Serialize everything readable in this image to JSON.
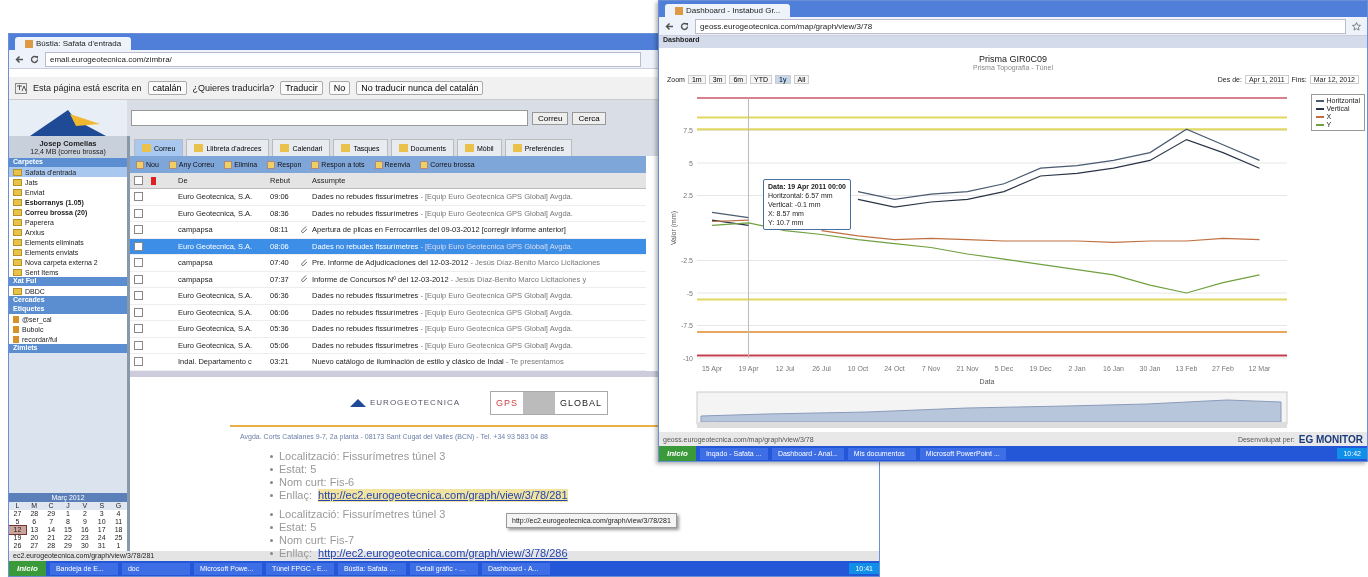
{
  "mail_window": {
    "tab_title": "Bústia: Safata d'entrada",
    "address": "email.eurogeotecnica.com/zimbra/",
    "translate_bar": {
      "message": "Esta página está escrita en",
      "language": "catalán",
      "question": "¿Quieres traducirla?",
      "buttons": [
        "Traducir",
        "No",
        "No traducir nunca del catalán"
      ]
    },
    "search": {
      "scope": "Correu",
      "button": "Cerca"
    },
    "user": {
      "name": "Josep Comellas",
      "quota": "12,4 MB (correu brossa)"
    },
    "app_tabs": [
      {
        "label": "Correu",
        "selected": true
      },
      {
        "label": "Llibreta d'adreces",
        "selected": false
      },
      {
        "label": "Calendari",
        "selected": false
      },
      {
        "label": "Tasques",
        "selected": false
      },
      {
        "label": "Documents",
        "selected": false
      },
      {
        "label": "Mòbil",
        "selected": false
      },
      {
        "label": "Preferències",
        "selected": false
      }
    ],
    "sidebar": [
      {
        "title": "Carpetes",
        "items": [
          {
            "label": "Safata d'entrada",
            "selected": true,
            "bold": false
          },
          {
            "label": "Jats",
            "selected": false,
            "bold": false
          },
          {
            "label": "Enviat",
            "selected": false,
            "bold": false
          },
          {
            "label": "Esborranys (1.05)",
            "selected": false,
            "bold": true
          },
          {
            "label": "Correu brossa (20)",
            "selected": false,
            "bold": true
          },
          {
            "label": "Paperera",
            "selected": false,
            "bold": false
          },
          {
            "label": "Arxius",
            "selected": false,
            "bold": false
          },
          {
            "label": "Elements eliminats",
            "selected": false,
            "bold": false
          },
          {
            "label": "Elements enviats",
            "selected": false,
            "bold": false
          },
          {
            "label": "Nova carpeta externa 2",
            "selected": false,
            "bold": false
          },
          {
            "label": "Sent Items",
            "selected": false,
            "bold": false
          }
        ]
      },
      {
        "title": "Xat Ful",
        "items": [
          {
            "label": "DBDC",
            "selected": false,
            "bold": false
          }
        ]
      },
      {
        "title": "Cercades"
      },
      {
        "title": "Etiquetes",
        "items": [
          {
            "label": "@ser_cal",
            "selected": false,
            "bold": false
          },
          {
            "label": "Bubolc",
            "selected": false,
            "bold": false
          },
          {
            "label": "recordar/ful",
            "selected": false,
            "bold": false
          }
        ]
      },
      {
        "title": "Zimlets"
      }
    ],
    "calendar": {
      "month": "Març 2012",
      "weekdays": [
        "L",
        "M",
        "C",
        "J",
        "V",
        "S",
        "G"
      ],
      "days": [
        {
          "label": "27",
          "today": false
        },
        {
          "label": "28",
          "today": false
        },
        {
          "label": "29",
          "today": false
        },
        {
          "label": "1",
          "today": false
        },
        {
          "label": "2",
          "today": false
        },
        {
          "label": "3",
          "today": false
        },
        {
          "label": "4",
          "today": false
        },
        {
          "label": "5",
          "today": false
        },
        {
          "label": "6",
          "today": false
        },
        {
          "label": "7",
          "today": false
        },
        {
          "label": "8",
          "today": false
        },
        {
          "label": "9",
          "today": false
        },
        {
          "label": "10",
          "today": false
        },
        {
          "label": "11",
          "today": false
        },
        {
          "label": "12",
          "today": true
        },
        {
          "label": "13",
          "today": false
        },
        {
          "label": "14",
          "today": false
        },
        {
          "label": "15",
          "today": false
        },
        {
          "label": "16",
          "today": false
        },
        {
          "label": "17",
          "today": false
        },
        {
          "label": "18",
          "today": false
        },
        {
          "label": "19",
          "today": false
        },
        {
          "label": "20",
          "today": false
        },
        {
          "label": "21",
          "today": false
        },
        {
          "label": "22",
          "today": false
        },
        {
          "label": "23",
          "today": false
        },
        {
          "label": "24",
          "today": false
        },
        {
          "label": "25",
          "today": false
        },
        {
          "label": "26",
          "today": false
        },
        {
          "label": "27",
          "today": false
        },
        {
          "label": "28",
          "today": false
        },
        {
          "label": "29",
          "today": false
        },
        {
          "label": "30",
          "today": false
        },
        {
          "label": "31",
          "today": false
        },
        {
          "label": "1",
          "today": false
        }
      ]
    },
    "toolbar": [
      "Nou",
      "Any Correu",
      "Elimina",
      "Respon",
      "Respon a tots",
      "Reenvia",
      "Correu brossa"
    ],
    "table": {
      "columns": [
        "De",
        "Rebut",
        "Assumpte"
      ],
      "all_checked": false,
      "rows": [
        {
          "from": "Euro Geotecnica, S.A.",
          "received": "09:06",
          "subject": "Dades no rebudes fissurímetres",
          "preview": "- [Equip Euro Geotecnica GPS Global] Avgda.",
          "attachment": false,
          "checked": false,
          "selected": false
        },
        {
          "from": "Euro Geotecnica, S.A.",
          "received": "08:36",
          "subject": "Dades no rebudes fissurímetres",
          "preview": "- [Equip Euro Geotecnica GPS Global] Avgda.",
          "attachment": false,
          "checked": false,
          "selected": false
        },
        {
          "from": "campapsa",
          "received": "08:11",
          "subject": "Apertura de plicas en Ferrocarriles del 09-03-2012 [corregir informe anterior]",
          "attachment": true,
          "checked": false,
          "selected": false
        },
        {
          "from": "Euro Geotecnica, S.A.",
          "received": "08:06",
          "subject": "Dades no rebudes fissurímetres",
          "preview": "- [Equip Euro Geotecnica GPS Global] Avgda.",
          "attachment": false,
          "checked": false,
          "selected": true
        },
        {
          "from": "campapsa",
          "received": "07:40",
          "subject": "Pre. Informe de Adjudicaciones del 12-03-2012",
          "preview": "- Jesús Díaz-Benito Marco Licitaciones",
          "attachment": true,
          "checked": false,
          "selected": false
        },
        {
          "from": "campapsa",
          "received": "07:37",
          "subject": "Informe de Concursos Nº del 12-03-2012",
          "preview": "- Jesús Díaz-Benito Marco Licitaciones y",
          "attachment": true,
          "checked": false,
          "selected": false
        },
        {
          "from": "Euro Geotecnica, S.A.",
          "received": "06:36",
          "subject": "Dades no rebudes fissurímetres",
          "preview": "- [Equip Euro Geotecnica GPS Global] Avgda.",
          "attachment": false,
          "checked": false,
          "selected": false
        },
        {
          "from": "Euro Geotecnica, S.A.",
          "received": "06:06",
          "subject": "Dades no rebudes fissurímetres",
          "preview": "- [Equip Euro Geotecnica GPS Global] Avgda.",
          "attachment": false,
          "checked": false,
          "selected": false
        },
        {
          "from": "Euro Geotecnica, S.A.",
          "received": "05:36",
          "subject": "Dades no rebudes fissurímetres",
          "preview": "- [Equip Euro Geotecnica GPS Global] Avgda.",
          "attachment": false,
          "checked": false,
          "selected": false
        },
        {
          "from": "Euro Geotecnica, S.A.",
          "received": "05:06",
          "subject": "Dades no rebudes fissurímetres",
          "preview": "- [Equip Euro Geotecnica GPS Global] Avgda.",
          "attachment": false,
          "checked": false,
          "selected": false
        },
        {
          "from": "Indal. Departamento c",
          "received": "03:21",
          "subject": "Nuevo catálogo de iluminación de estilo y clásico de Indal",
          "preview": "- Te presentamos",
          "attachment": false,
          "checked": false,
          "selected": false
        }
      ]
    },
    "message": {
      "logo_left": "EUROGEOTECNICA",
      "logo_right_a": "GPS",
      "logo_right_b": "GLOBAL",
      "address": "Avgda. Corts Catalanes 9-7, 2a planta - 08173 Sant Cugat del Vallès (BCN) - Tel. +34 93 583 04 88",
      "items": [
        {
          "lines": [
            "Localització: Fissurímetres túnel 3",
            "Estat: 5",
            "Nom curt: Fis-6"
          ],
          "link_label": "Enllaç:",
          "link": "http://ec2.eurogeotecnica.com/graph/view/3/78/281",
          "hovered": true
        },
        {
          "lines": [
            "Localització: Fissurímetres túnel 3",
            "Estat: 5",
            "Nom curt: Fis-7"
          ],
          "link_label": "Enllaç:",
          "link": "http://ec2.eurogeotecnica.com/graph/view/3/78/286",
          "hovered": false
        }
      ],
      "tooltip": "http://ec2.eurogeotecnica.com/graph/view/3/78/281"
    },
    "status_url": "ec2.eurogeotecnica.com/graph/view/3/78/281",
    "taskbar": {
      "start": "Inicio",
      "tasks": [
        "Bandeja de E...",
        "doc",
        "Microsoft Powe...",
        "Túnel FPGC - E...",
        "Bústia: Safata ...",
        "Detall gràfic - ...",
        "Dashboard - A..."
      ],
      "clock": "10:41"
    }
  },
  "chart_window": {
    "tab_title": "Dashboard - Instabud Gr...",
    "address": "geoss.eurogeotecnica.com/map/graph/view/3/78",
    "toolbar_label": "Dashboard",
    "chart": {
      "title": "Prisma GIR0C09",
      "subtitle": "Prisma Topografia - Túnel",
      "zoom_label": "Zoom",
      "zoom_buttons": [
        {
          "label": "1m",
          "selected": false
        },
        {
          "label": "3m",
          "selected": false
        },
        {
          "label": "6m",
          "selected": false
        },
        {
          "label": "YTD",
          "selected": false
        },
        {
          "label": "1y",
          "selected": true
        },
        {
          "label": "All",
          "selected": false
        }
      ],
      "from_label": "Des de:",
      "from": "Apr 1, 2011",
      "to_label": "Fins:",
      "to": "Mar 12, 2012",
      "tooltip": [
        "Data: 19 Apr 2011 00:00",
        "Horitzontal: 6.57 mm",
        "Vertical: -0.1 mm",
        "X: 8.57 mm",
        "Y: 10.7 mm"
      ],
      "chart_data": {
        "type": "line",
        "xlabel": "Data",
        "ylabel": "Valor (mm)",
        "categories": [
          "15 Apr",
          "19 Apr",
          "12 Jul",
          "26 Jul",
          "10 Oct",
          "24 Oct",
          "7 Nov",
          "21 Nov",
          "5 Dec",
          "19 Dec",
          "2 Jan",
          "16 Jan",
          "30 Jan",
          "13 Feb",
          "27 Feb",
          "12 Mar"
        ],
        "series": [
          {
            "name": "Horitzontal",
            "color": "#4a5a70",
            "values": [
              1.2,
              0.8,
              null,
              null,
              2.8,
              2.2,
              2.6,
              2.8,
              3.4,
              4.6,
              4.8,
              5.2,
              5.8,
              7.6,
              6.4,
              5.2
            ]
          },
          {
            "name": "Vertical",
            "color": "#2a3446",
            "values": [
              0.6,
              0.2,
              null,
              null,
              2.2,
              1.6,
              2.0,
              2.2,
              2.8,
              4.0,
              4.2,
              4.6,
              5.2,
              6.8,
              5.8,
              4.6
            ]
          },
          {
            "name": "X",
            "color": "#c07040",
            "values": [
              0.5,
              0.6,
              null,
              -0.2,
              -0.6,
              -0.9,
              -0.8,
              -0.9,
              -1.0,
              -1.0,
              -1.0,
              -1.1,
              -1.0,
              -1.0,
              -0.8,
              -0.9
            ]
          },
          {
            "name": "Y",
            "color": "#70a040",
            "values": [
              0.2,
              0.4,
              -0.2,
              -0.5,
              -0.9,
              -1.2,
              -1.5,
              -2.0,
              -2.4,
              -2.8,
              -3.2,
              -3.6,
              -4.4,
              -5.0,
              -4.2,
              -3.6
            ]
          }
        ],
        "ylim": [
          -10,
          10
        ],
        "yticks": [
          7.5,
          5,
          2.5,
          -2.5,
          -5,
          -7.5,
          -10
        ],
        "grid": true,
        "ref_lines": [
          {
            "axis": "y",
            "value": 10,
            "color": "#d88090"
          },
          {
            "axis": "y",
            "value": 8.5,
            "color": "#e0d860"
          },
          {
            "axis": "y",
            "value": 7.6,
            "color": "#e0d860"
          },
          {
            "axis": "y",
            "value": -5.5,
            "color": "#e0d860"
          },
          {
            "axis": "y",
            "value": -8,
            "color": "#e8a860"
          },
          {
            "axis": "y",
            "value": -9.8,
            "color": "#c84050"
          },
          {
            "axis": "x",
            "value": "19 Apr",
            "color": "#bbbbbb"
          }
        ]
      }
    },
    "status_url": "geoss.eurogeotecnica.com/map/graph/view/3/78",
    "brand": "EG MONITOR",
    "brand_prefix": "Desenvolupat per:",
    "taskbar": {
      "start": "Inicio",
      "tasks": [
        "Inqado - Safata ...",
        "Dashboard - Anal...",
        "Mis documentos",
        "Microsoft PowerPoint ..."
      ],
      "clock": "10:42"
    }
  }
}
